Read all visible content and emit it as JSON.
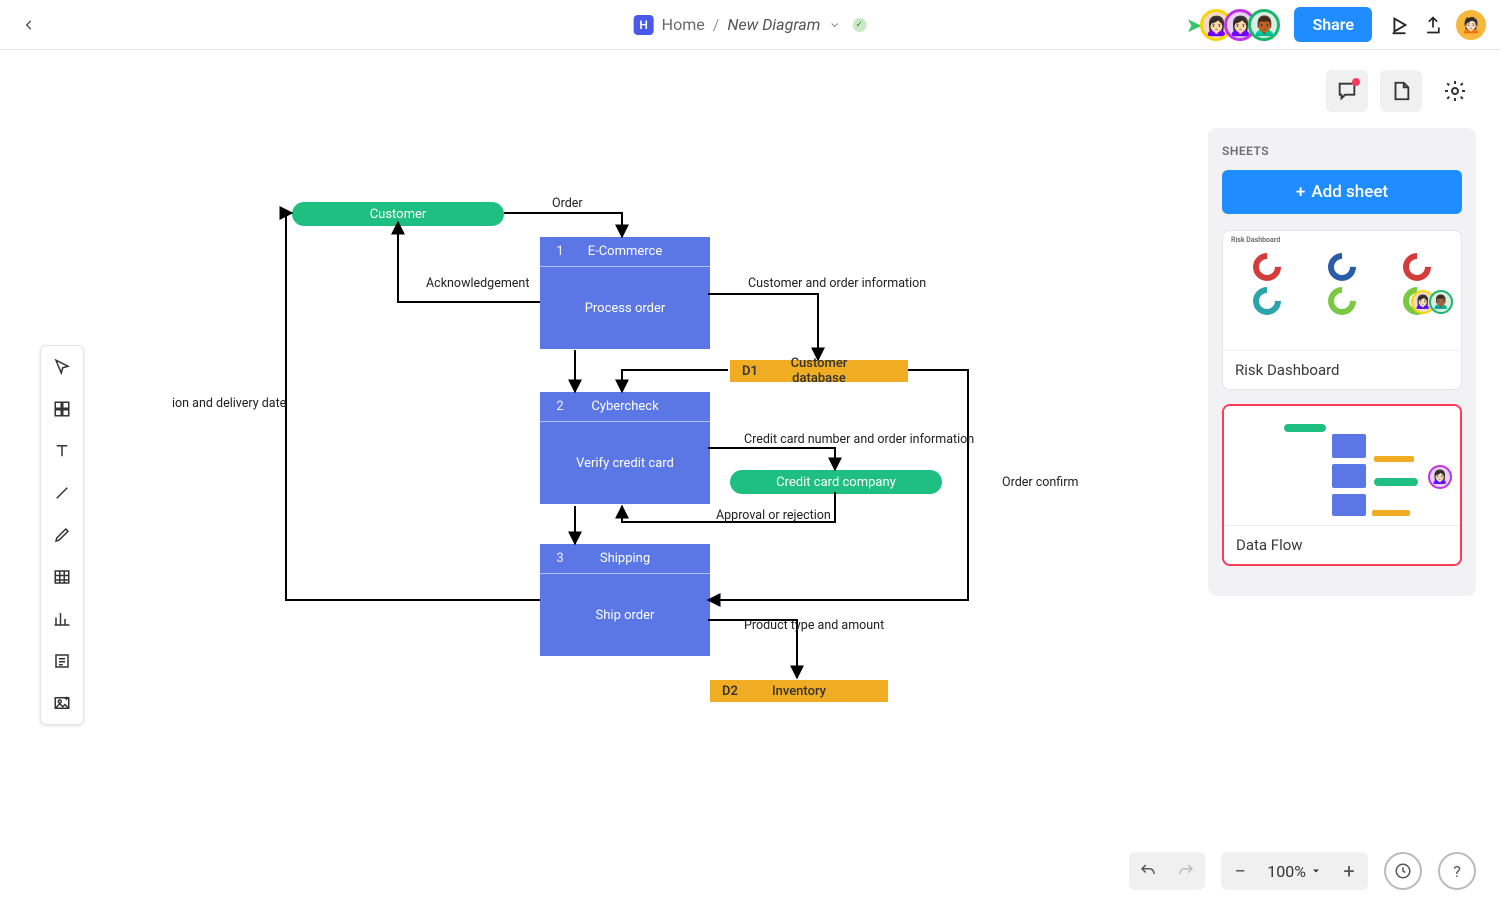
{
  "header": {
    "home_label": "Home",
    "doc_label": "New Diagram",
    "share_label": "Share"
  },
  "sheets_panel": {
    "title": "SHEETS",
    "add_label": "Add sheet",
    "cards": [
      {
        "label": "Risk Dashboard",
        "thumb_title": "Risk Dashboard"
      },
      {
        "label": "Data Flow"
      }
    ]
  },
  "zoom": {
    "value": "100%"
  },
  "diagram": {
    "entities": {
      "customer": "Customer",
      "credit_company": "Credit card company"
    },
    "processes": [
      {
        "num": "1",
        "title": "E-Commerce",
        "body": "Process order"
      },
      {
        "num": "2",
        "title": "Cybercheck",
        "body": "Verify credit card"
      },
      {
        "num": "3",
        "title": "Shipping",
        "body": "Ship order"
      }
    ],
    "datastores": [
      {
        "tag": "D1",
        "title": "Customer database"
      },
      {
        "tag": "D2",
        "title": "Inventory"
      }
    ],
    "edges": {
      "order": "Order",
      "ack": "Acknowledgement",
      "cust_order_info": "Customer and order information",
      "cc_info": "Credit card number and order information",
      "approval": "Approval or rejection",
      "product": "Product type and amount",
      "ion_delivery": "ion and delivery date",
      "confirm": "Order confirm"
    }
  }
}
